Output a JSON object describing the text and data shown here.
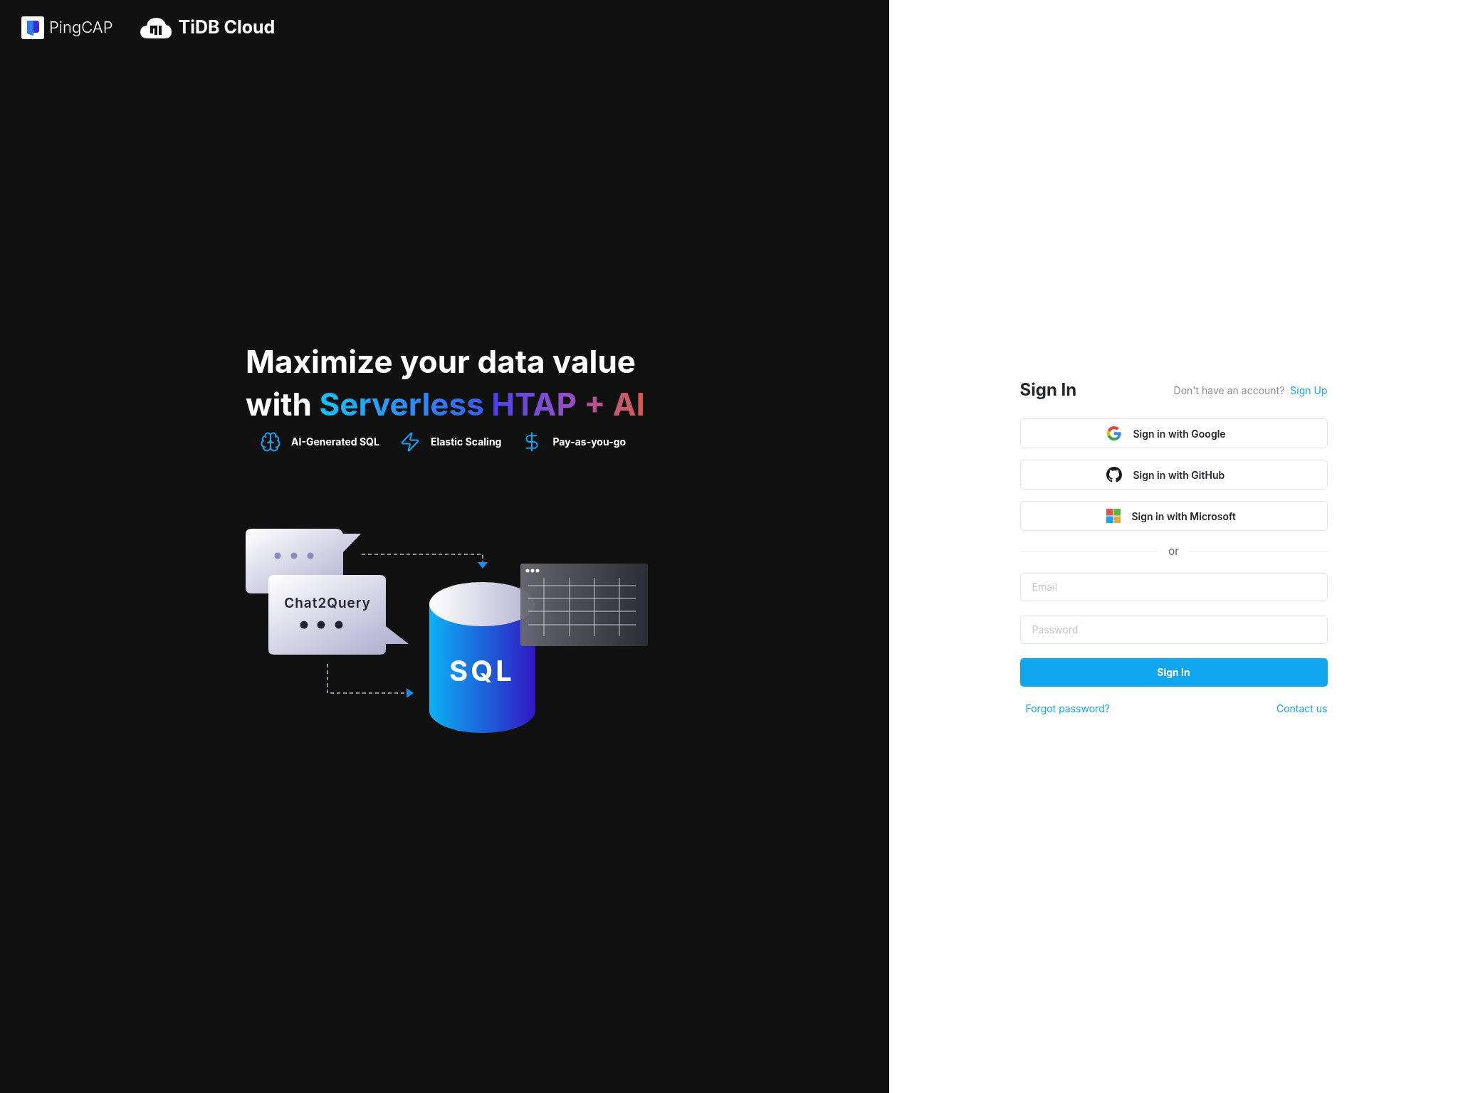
{
  "header": {
    "company": "PingCAP",
    "product": "TiDB Cloud"
  },
  "headline": {
    "line_1": "Maximize your data value",
    "line_2": [
      {
        "text": "with",
        "kind": "plain"
      },
      {
        "text": "Serverless",
        "kind": "gradient"
      },
      {
        "text": "HTAP",
        "kind": "gradient"
      },
      {
        "text": "+ AI",
        "kind": "gradient"
      }
    ]
  },
  "features": [
    {
      "label": "AI-Generated SQL",
      "kind": "brain"
    },
    {
      "label": "Elastic Scaling",
      "kind": "bolt"
    },
    {
      "label": "Pay-as-you-go",
      "kind": "dollar"
    }
  ],
  "illustration": {
    "bubble_label": "Chat2Query",
    "database_label": "SQL"
  },
  "sign_in": {
    "title": "Sign In",
    "prompt": "Don't have an account?",
    "sign_up": "Sign Up",
    "providers": [
      {
        "label": "Sign in with Google",
        "kind": "google"
      },
      {
        "label": "Sign in with GitHub",
        "kind": "github"
      },
      {
        "label": "Sign in with Microsoft",
        "kind": "microsoft"
      }
    ],
    "divider": "or",
    "fields": [
      {
        "placeholder": "Email"
      },
      {
        "placeholder": "Password"
      }
    ],
    "submit": "Sign In",
    "forgot": "Forgot password?",
    "contact": "Contact us"
  }
}
